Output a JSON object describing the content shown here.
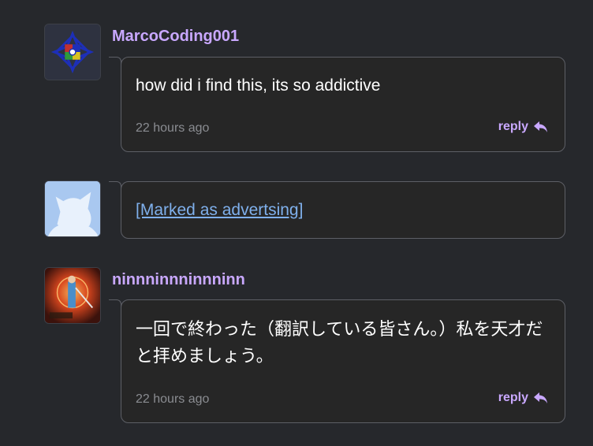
{
  "comments": [
    {
      "username": "MarcoCoding001",
      "text": "how did i find this, its so addictive",
      "timestamp": "22 hours ago",
      "reply_label": "reply"
    },
    {
      "username": "",
      "text": "[Marked as advertsing]"
    },
    {
      "username": "ninnninnninnninn",
      "text": "一回で終わった（翻訳している皆さん。）私を天才だと拝めましょう。",
      "timestamp": "22 hours ago",
      "reply_label": "reply"
    }
  ],
  "colors": {
    "background": "#26282c",
    "username": "#c9a8ff",
    "link": "#7fb0ec",
    "timestamp": "#8a8c91",
    "border": "#5d5f66"
  },
  "icons": {
    "reply": "reply-arrow-icon"
  }
}
